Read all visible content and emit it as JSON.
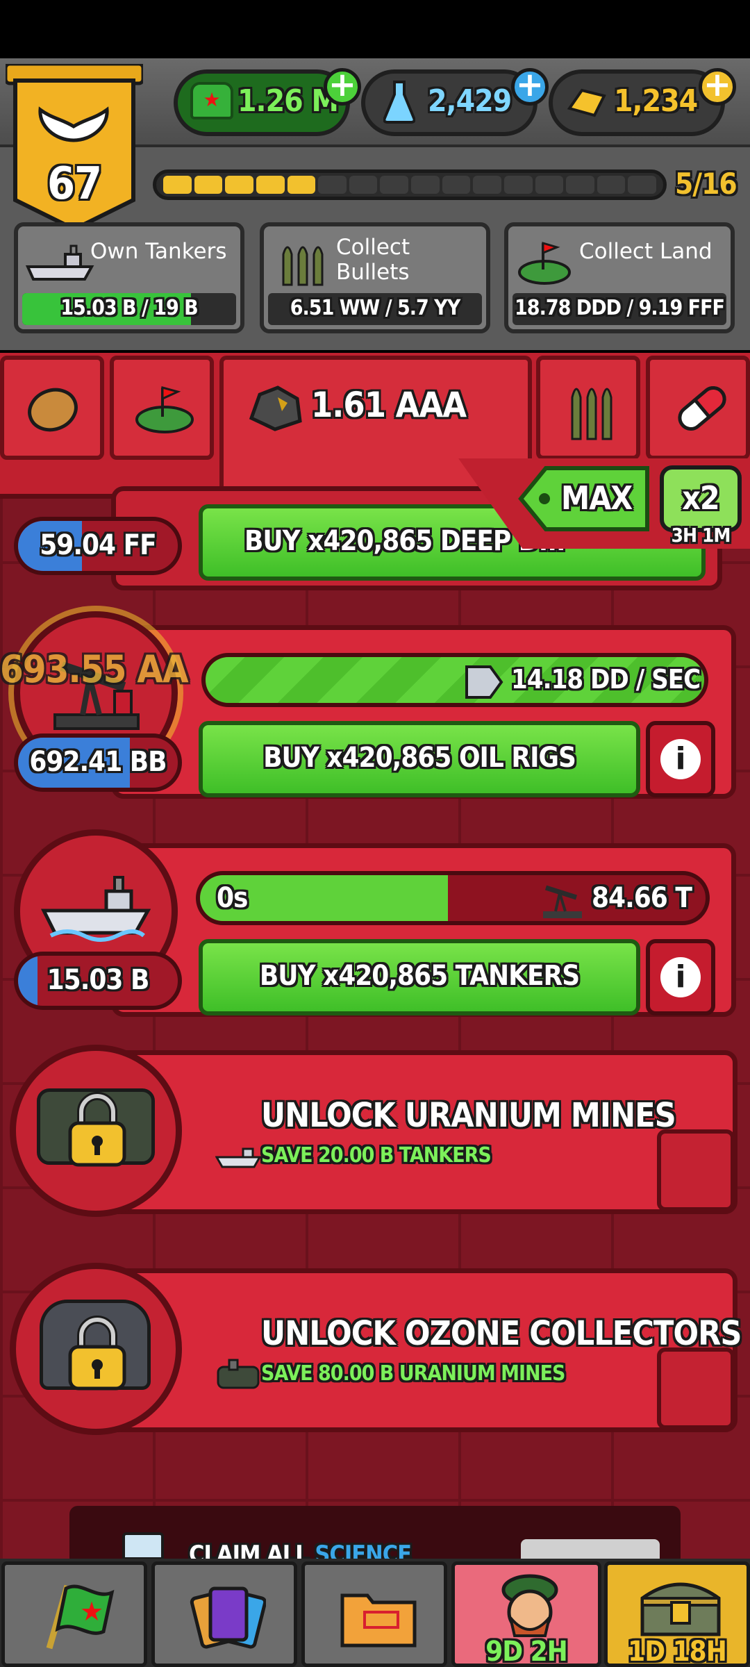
{
  "currencies": {
    "cash": "1.26 M",
    "science": "2,429",
    "gold": "1,234"
  },
  "level": {
    "value": "67",
    "progress_text": "5/16",
    "progress_filled": 5,
    "progress_total": 16
  },
  "quests": [
    {
      "label": "Own Tankers",
      "progress": "15.03 B / 19 B",
      "fill": 0.79
    },
    {
      "label": "Collect\nBullets",
      "progress": "6.51 WW / 5.7 YY",
      "fill": 0.0
    },
    {
      "label": "Collect Land",
      "progress": "18.78 DDD / 9.19 FFF",
      "fill": 0.0
    }
  ],
  "resource_tab": {
    "selected_amount": "1.61 AAA"
  },
  "buy_mode": {
    "label": "MAX",
    "boost_label": "x2",
    "boost_timer": "3H 1M"
  },
  "rows": {
    "deep_drill": {
      "counter": "59.04 FF",
      "buy_label": "BUY x420,865 DEEP D..."
    },
    "oil_rig": {
      "floating_amount": "693.55 AA",
      "rate": "14.18 DD / SEC",
      "counter": "692.41 BB",
      "buy_label": "BUY x420,865 OIL RIGS"
    },
    "tanker": {
      "timer": "0s",
      "amount": "84.66 T",
      "counter": "15.03 B",
      "buy_label": "BUY x420,865 TANKERS",
      "progress_fill": 0.49
    },
    "uranium": {
      "title": "UNLOCK URANIUM MINES",
      "subtitle": "SAVE 20.00 B TANKERS"
    },
    "ozone": {
      "title": "UNLOCK OZONE COLLECTORS",
      "subtitle": "SAVE 80.00 B URANIUM MINES"
    }
  },
  "claim_banner": {
    "text": "CLAIM ALL",
    "highlight": "SCIENCE"
  },
  "nav": {
    "general_timer": "9D 2H",
    "chest_timer": "1D 18H"
  },
  "colors": {
    "accent_green": "#5fd23a",
    "panel_red": "#d8283a",
    "gold": "#f2c12e",
    "blue": "#3b7fd9"
  }
}
